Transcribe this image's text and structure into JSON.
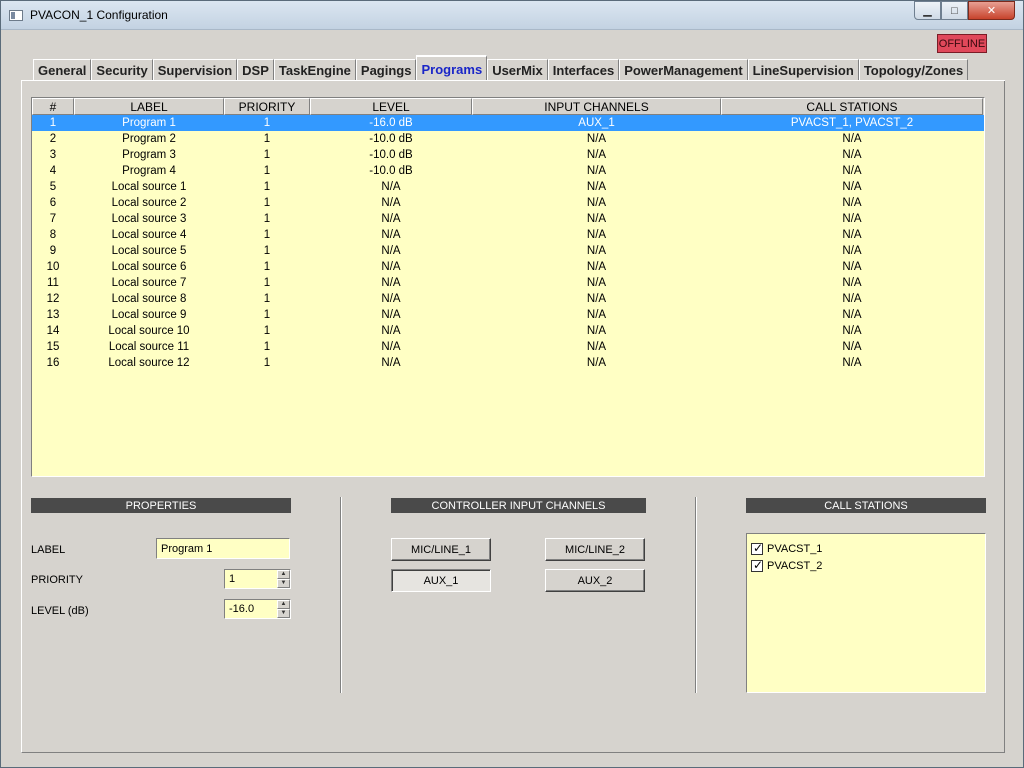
{
  "window": {
    "title": "PVACON_1 Configuration",
    "status_badge": "OFFLINE"
  },
  "tabs": [
    {
      "label": "General"
    },
    {
      "label": "Security"
    },
    {
      "label": "Supervision"
    },
    {
      "label": "DSP"
    },
    {
      "label": "TaskEngine"
    },
    {
      "label": "Pagings"
    },
    {
      "label": "Programs",
      "active": true
    },
    {
      "label": "UserMix"
    },
    {
      "label": "Interfaces"
    },
    {
      "label": "PowerManagement"
    },
    {
      "label": "LineSupervision"
    },
    {
      "label": "Topology/Zones"
    }
  ],
  "grid": {
    "columns": [
      "#",
      "LABEL",
      "PRIORITY",
      "LEVEL",
      "INPUT CHANNELS",
      "CALL STATIONS"
    ],
    "rows": [
      [
        "1",
        "Program 1",
        "1",
        "-16.0 dB",
        "AUX_1",
        "PVACST_1, PVACST_2"
      ],
      [
        "2",
        "Program 2",
        "1",
        "-10.0 dB",
        "N/A",
        "N/A"
      ],
      [
        "3",
        "Program 3",
        "1",
        "-10.0 dB",
        "N/A",
        "N/A"
      ],
      [
        "4",
        "Program 4",
        "1",
        "-10.0 dB",
        "N/A",
        "N/A"
      ],
      [
        "5",
        "Local source 1",
        "1",
        "N/A",
        "N/A",
        "N/A"
      ],
      [
        "6",
        "Local source 2",
        "1",
        "N/A",
        "N/A",
        "N/A"
      ],
      [
        "7",
        "Local source 3",
        "1",
        "N/A",
        "N/A",
        "N/A"
      ],
      [
        "8",
        "Local source 4",
        "1",
        "N/A",
        "N/A",
        "N/A"
      ],
      [
        "9",
        "Local source 5",
        "1",
        "N/A",
        "N/A",
        "N/A"
      ],
      [
        "10",
        "Local source 6",
        "1",
        "N/A",
        "N/A",
        "N/A"
      ],
      [
        "11",
        "Local source 7",
        "1",
        "N/A",
        "N/A",
        "N/A"
      ],
      [
        "12",
        "Local source 8",
        "1",
        "N/A",
        "N/A",
        "N/A"
      ],
      [
        "13",
        "Local source 9",
        "1",
        "N/A",
        "N/A",
        "N/A"
      ],
      [
        "14",
        "Local source 10",
        "1",
        "N/A",
        "N/A",
        "N/A"
      ],
      [
        "15",
        "Local source 11",
        "1",
        "N/A",
        "N/A",
        "N/A"
      ],
      [
        "16",
        "Local source 12",
        "1",
        "N/A",
        "N/A",
        "N/A"
      ]
    ],
    "selected_row": 0
  },
  "properties": {
    "header": "PROPERTIES",
    "label_caption": "LABEL",
    "label_value": "Program 1",
    "priority_caption": "PRIORITY",
    "priority_value": "1",
    "level_caption": "LEVEL (dB)",
    "level_value": "-16.0"
  },
  "controller_inputs": {
    "header": "CONTROLLER INPUT CHANNELS",
    "buttons": [
      {
        "label": "MIC/LINE_1",
        "pressed": false
      },
      {
        "label": "MIC/LINE_2",
        "pressed": false
      },
      {
        "label": "AUX_1",
        "pressed": true
      },
      {
        "label": "AUX_2",
        "pressed": false
      }
    ]
  },
  "call_stations": {
    "header": "CALL STATIONS",
    "items": [
      {
        "label": "PVACST_1",
        "checked": true
      },
      {
        "label": "PVACST_2",
        "checked": true
      }
    ]
  },
  "icons": {
    "app": "window-app-icon",
    "minimize": "minimize-icon",
    "maximize": "maximize-icon",
    "close": "close-icon",
    "spin_up": "spin-up-icon",
    "spin_down": "spin-down-icon",
    "checkbox": "checkbox-checked-icon"
  },
  "colors": {
    "grid_bg": "#ffffc4",
    "selection": "#3399ff",
    "offline_badge": "#e0485a",
    "active_tab_text": "#1a26c8"
  }
}
